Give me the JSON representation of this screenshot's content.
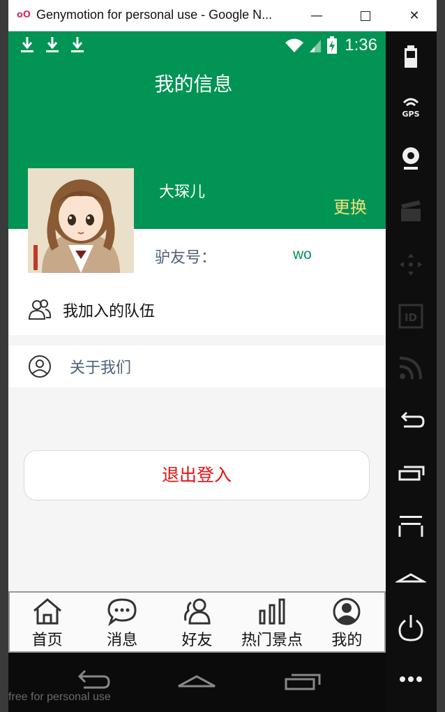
{
  "window": {
    "title": "Genymotion for personal use - Google N...",
    "minimize_label": "—",
    "close_label": "✕"
  },
  "statusbar": {
    "time": "1:36",
    "icons": [
      "download-icon",
      "download-icon",
      "download-icon",
      "wifi-icon",
      "signal-icon",
      "battery-charging-icon"
    ]
  },
  "header": {
    "title": "我的信息"
  },
  "profile": {
    "nickname": "大琛儿",
    "change_label": "更换",
    "id_label": "驴友号：",
    "id_value": "wo"
  },
  "menu": {
    "team_label": "我加入的队伍",
    "about_label": "关于我们"
  },
  "logout": {
    "label": "退出登入"
  },
  "tabs": [
    {
      "label": "首页",
      "icon": "home-icon"
    },
    {
      "label": "消息",
      "icon": "chat-icon"
    },
    {
      "label": "好友",
      "icon": "friends-icon"
    },
    {
      "label": "热门景点",
      "icon": "bar-chart-icon"
    },
    {
      "label": "我的",
      "icon": "user-icon"
    }
  ],
  "navbar": {
    "watermark": "free for personal use"
  },
  "colors": {
    "brand_green": "#019455",
    "logout_red": "#e8100f",
    "change_yellow": "#f3e07a"
  }
}
